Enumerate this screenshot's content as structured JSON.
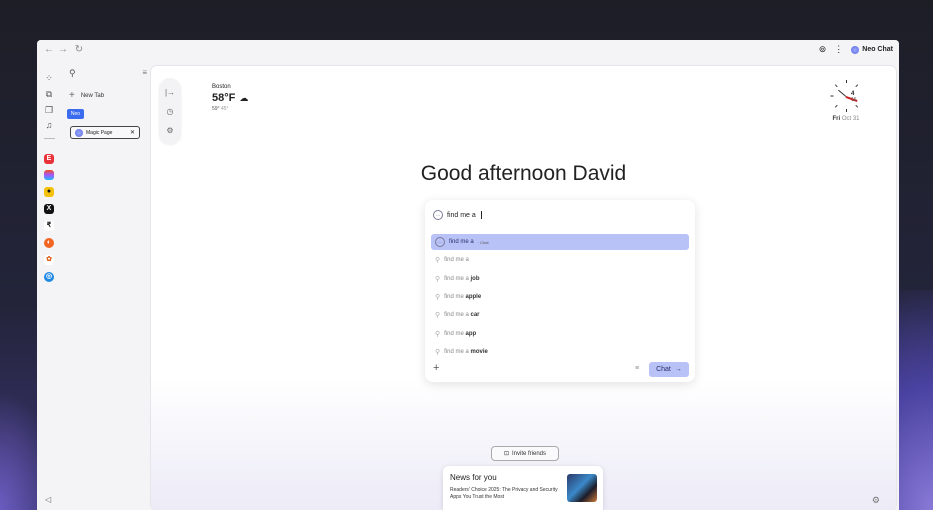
{
  "browser": {
    "back_icon": "←",
    "forward_icon": "→",
    "reload_icon": "↻",
    "profile_icon": "⊚",
    "menu_icon": "⋮",
    "neo_chat_label": "Neo Chat"
  },
  "sidebar": {
    "new_tab_label": "New Tab",
    "neo_badge": "Neo",
    "tabs": [
      {
        "label": "Magic Page"
      }
    ]
  },
  "weather": {
    "city": "Boston",
    "temp": "58°F",
    "condition_icon": "☁",
    "high": "59°",
    "low": "45°"
  },
  "clock": {
    "hour_number": "4",
    "minute_number": "16",
    "day": "Fri",
    "month_day": "Oct 31"
  },
  "greeting": "Good afternoon David",
  "search": {
    "query": "find me a",
    "suggestions": [
      {
        "prefix": "find me a",
        "bold": "",
        "tag": "· Chat",
        "active": true
      },
      {
        "prefix": "find me a",
        "bold": "",
        "tag": "",
        "active": false
      },
      {
        "prefix": "find me a ",
        "bold": "job",
        "tag": "",
        "active": false
      },
      {
        "prefix": "find me ",
        "bold": "apple",
        "tag": "",
        "active": false
      },
      {
        "prefix": "find me a ",
        "bold": "car",
        "tag": "",
        "active": false
      },
      {
        "prefix": "find me ",
        "bold": "app",
        "tag": "",
        "active": false
      },
      {
        "prefix": "find me a ",
        "bold": "movie",
        "tag": "",
        "active": false
      }
    ],
    "chat_button": "Chat",
    "chat_arrow": "→"
  },
  "invite_label": "Invite friends",
  "news": {
    "title": "News for you",
    "headline": "Readers' Choice 2025: The Privacy and Security Apps You Trust the Most"
  },
  "colors": {
    "accent": "#3b6cf0",
    "suggest_active": "#b9c2f7"
  }
}
